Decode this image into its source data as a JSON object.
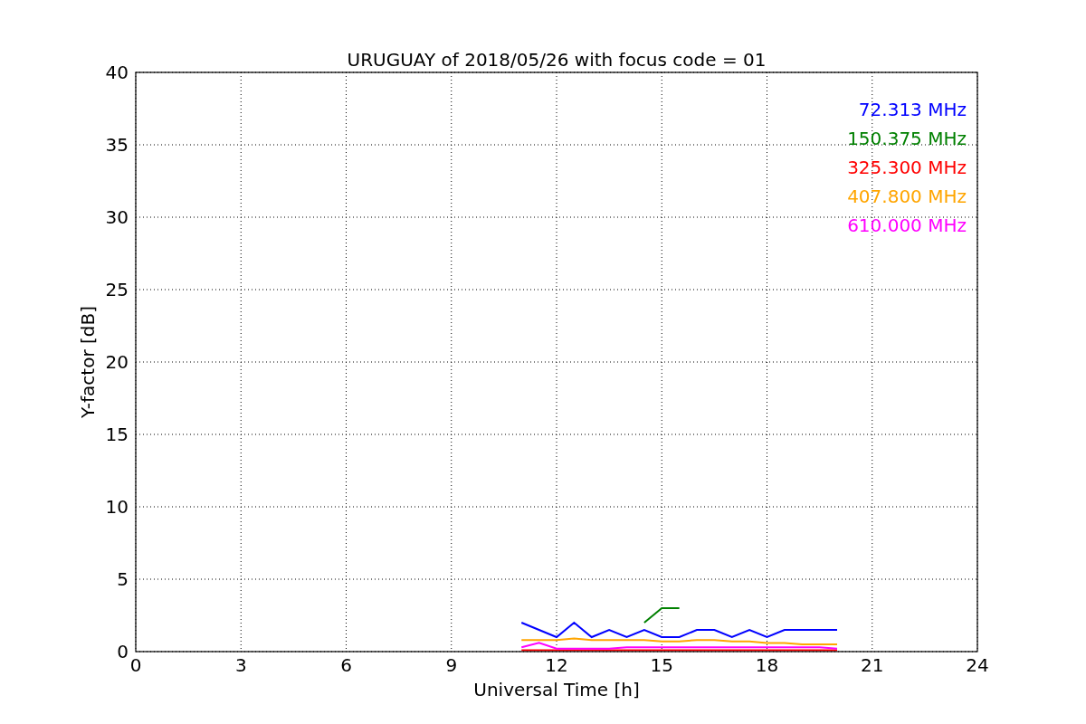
{
  "chart": {
    "chart_data": {
      "type": "line",
      "title": "URUGUAY of 2018/05/26 with focus code = 01",
      "xlabel": "Universal Time [h]",
      "ylabel": "Y-factor [dB]",
      "x": [
        11,
        11.5,
        12,
        12.5,
        13,
        13.5,
        14,
        14.5,
        15,
        15.5,
        16,
        16.5,
        17,
        17.5,
        18,
        18.5,
        19,
        19.5,
        20
      ],
      "series": [
        {
          "name": "72.313 MHz",
          "color": "#0000ff",
          "values": [
            2,
            1.5,
            1,
            2,
            1,
            1.5,
            1,
            1.5,
            1,
            1,
            1.5,
            1.5,
            1,
            1.5,
            1,
            1.5,
            1.5,
            1.5,
            1.5
          ]
        },
        {
          "name": "150.375 MHz",
          "color": "#008000",
          "values": [
            null,
            null,
            null,
            null,
            null,
            null,
            null,
            2,
            3,
            3,
            null,
            null,
            null,
            null,
            null,
            null,
            null,
            null,
            null
          ]
        },
        {
          "name": "325.300 MHz",
          "color": "#ff0000",
          "values": [
            0.1,
            0.1,
            0.1,
            0.1,
            0.1,
            0.1,
            0.1,
            0.1,
            0.1,
            0.1,
            0.1,
            0.1,
            0.1,
            0.1,
            0.1,
            0.1,
            0.1,
            0.1,
            0.1
          ]
        },
        {
          "name": "407.800 MHz",
          "color": "#ffa500",
          "values": [
            0.8,
            0.8,
            0.8,
            0.9,
            0.8,
            0.8,
            0.8,
            0.8,
            0.7,
            0.7,
            0.8,
            0.8,
            0.7,
            0.7,
            0.6,
            0.6,
            0.5,
            0.5,
            0.5
          ]
        },
        {
          "name": "610.000 MHz",
          "color": "#ff00ff",
          "values": [
            0.3,
            0.6,
            0.2,
            0.2,
            0.2,
            0.2,
            0.3,
            0.3,
            0.3,
            0.3,
            0.3,
            0.3,
            0.3,
            0.3,
            0.3,
            0.3,
            0.3,
            0.3,
            0.2
          ]
        }
      ],
      "xlim": [
        0,
        24
      ],
      "ylim": [
        0,
        40
      ],
      "xticks": [
        0,
        3,
        6,
        9,
        12,
        15,
        18,
        21,
        24
      ],
      "yticks": [
        0,
        5,
        10,
        15,
        20,
        25,
        30,
        35,
        40
      ],
      "grid": true
    }
  }
}
